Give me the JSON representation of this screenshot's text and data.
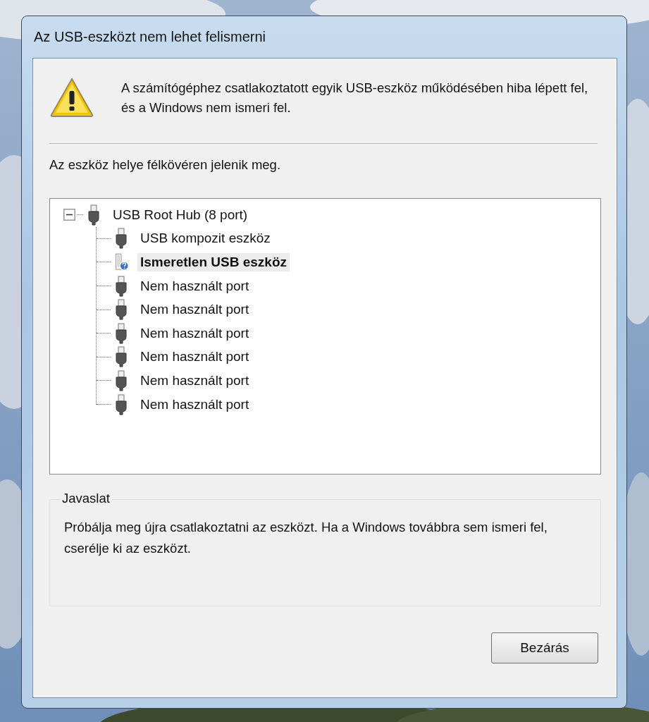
{
  "window": {
    "title": "Az USB-eszközt nem lehet felismerni"
  },
  "message": "A számítógéphez csatlakoztatott egyik USB-eszköz működésében hiba lépett fel, és a Windows nem ismeri fel.",
  "location_note": "Az eszköz helye félkövéren jelenik meg.",
  "device_tree": {
    "label": "USB Root Hub (8 port)",
    "kind": "device",
    "selected": false,
    "expanded": true,
    "children": [
      {
        "label": "USB kompozit eszköz",
        "kind": "device",
        "selected": false
      },
      {
        "label": "Ismeretlen USB eszköz",
        "kind": "unknown",
        "selected": true
      },
      {
        "label": "Nem használt port",
        "kind": "device",
        "selected": false
      },
      {
        "label": "Nem használt port",
        "kind": "device",
        "selected": false
      },
      {
        "label": "Nem használt port",
        "kind": "device",
        "selected": false
      },
      {
        "label": "Nem használt port",
        "kind": "device",
        "selected": false
      },
      {
        "label": "Nem használt port",
        "kind": "device",
        "selected": false
      },
      {
        "label": "Nem használt port",
        "kind": "device",
        "selected": false
      }
    ]
  },
  "suggestion": {
    "title": "Javaslat",
    "text": "Próbálja meg újra csatlakoztatni az eszközt. Ha a Windows továbbra sem ismeri fel, cserélje ki az eszközt."
  },
  "buttons": [
    "Bezárás"
  ]
}
